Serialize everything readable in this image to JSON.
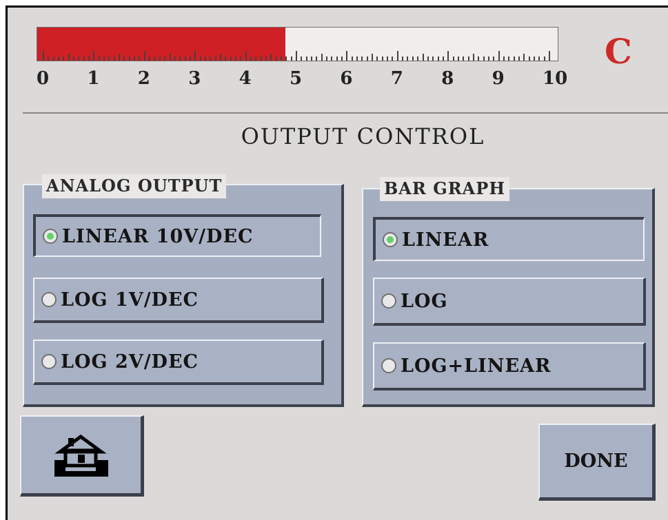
{
  "bar_graph": {
    "value": 4.8,
    "scale_min": 0,
    "scale_max": 10,
    "scale_labels": [
      "0",
      "1",
      "2",
      "3",
      "4",
      "5",
      "6",
      "7",
      "8",
      "9",
      "10"
    ],
    "fill_color": "#cf2125"
  },
  "units": "C",
  "title": "OUTPUT CONTROL",
  "analog_output": {
    "label": "ANALOG OUTPUT",
    "options": [
      {
        "label": "LINEAR 10V/DEC",
        "selected": true
      },
      {
        "label": "LOG 1V/DEC",
        "selected": false
      },
      {
        "label": "LOG 2V/DEC",
        "selected": false
      }
    ]
  },
  "bar_graph_mode": {
    "label": "BAR GRAPH",
    "options": [
      {
        "label": "LINEAR",
        "selected": true
      },
      {
        "label": "LOG",
        "selected": false
      },
      {
        "label": "LOG+LINEAR",
        "selected": false
      }
    ]
  },
  "buttons": {
    "home_icon": "home-icon",
    "done_label": "DONE"
  }
}
